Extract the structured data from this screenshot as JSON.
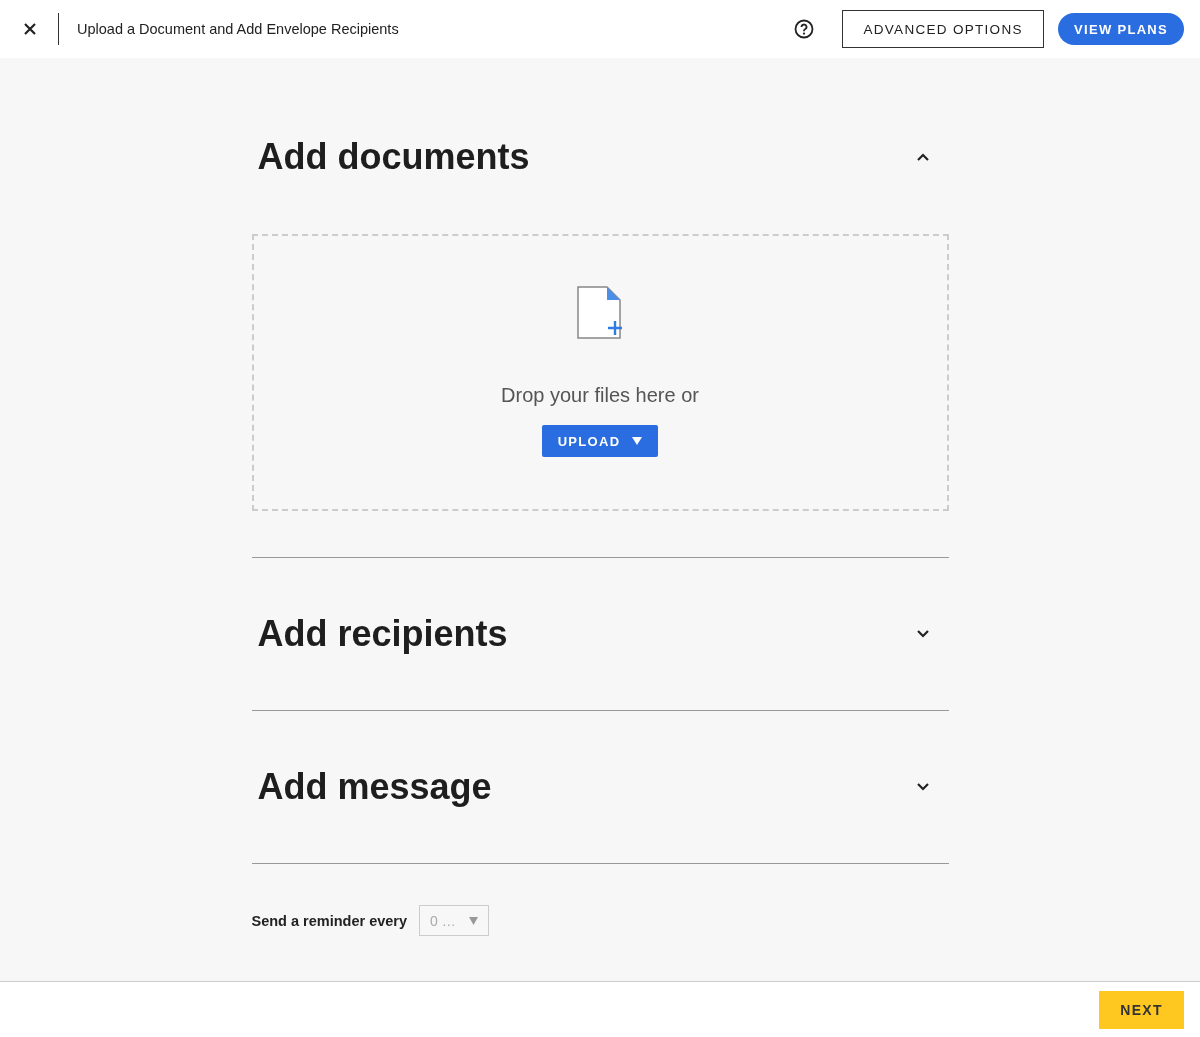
{
  "header": {
    "title": "Upload a Document and Add Envelope Recipients",
    "buttons": [
      {
        "label": "ADVANCED OPTIONS",
        "kind": "outline"
      },
      {
        "label": "VIEW PLANS",
        "kind": "primary"
      }
    ]
  },
  "sections": [
    {
      "title": "Add documents",
      "expanded": true,
      "drop_zone": {
        "text": "Drop your files here or",
        "button": "UPLOAD"
      }
    },
    {
      "title": "Add recipients",
      "expanded": false
    },
    {
      "title": "Add message",
      "expanded": false
    }
  ],
  "reminder": {
    "label": "Send a reminder every",
    "value": "0 …",
    "disabled": true
  },
  "footer": {
    "button": "NEXT"
  }
}
